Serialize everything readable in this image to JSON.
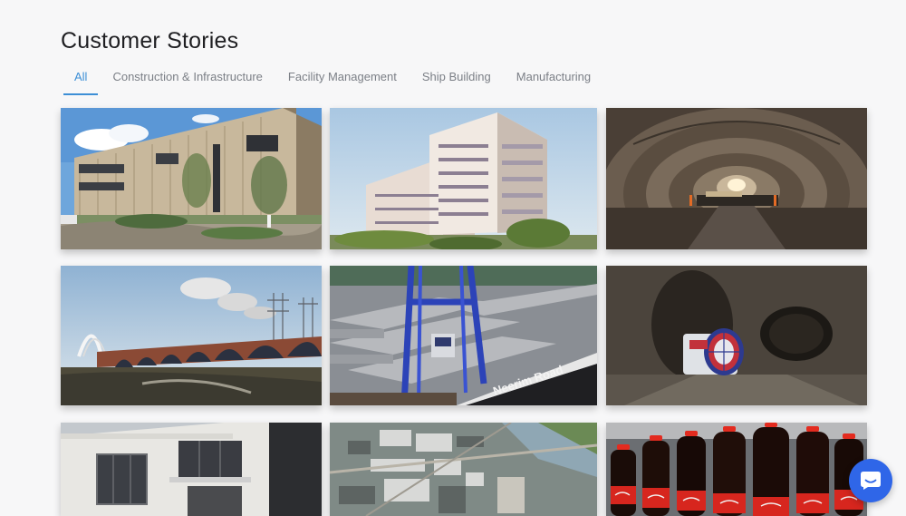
{
  "page": {
    "title": "Customer Stories"
  },
  "tabs": [
    {
      "label": "All",
      "active": true
    },
    {
      "label": "Construction & Infrastructure",
      "active": false
    },
    {
      "label": "Facility Management",
      "active": false
    },
    {
      "label": "Ship Building",
      "active": false
    },
    {
      "label": "Manufacturing",
      "active": false
    }
  ],
  "stories": [
    {
      "image": "timber-clad-office-building"
    },
    {
      "image": "residential-apartment-tower"
    },
    {
      "image": "road-tunnel-with-paving-crew"
    },
    {
      "image": "arched-railway-viaduct"
    },
    {
      "image": "gantry-crane-precast-yard",
      "sign_text": "Neerim Road"
    },
    {
      "image": "tunnel-boring-machine"
    },
    {
      "image": "modern-villa-render"
    },
    {
      "image": "aerial-industrial-harbour"
    },
    {
      "image": "cola-bottling-line"
    }
  ],
  "chat": {
    "icon": "chat-bubble-icon"
  },
  "colors": {
    "accent": "#3d8fd6",
    "chat": "#2f66e8",
    "background": "#f7f7f8"
  }
}
